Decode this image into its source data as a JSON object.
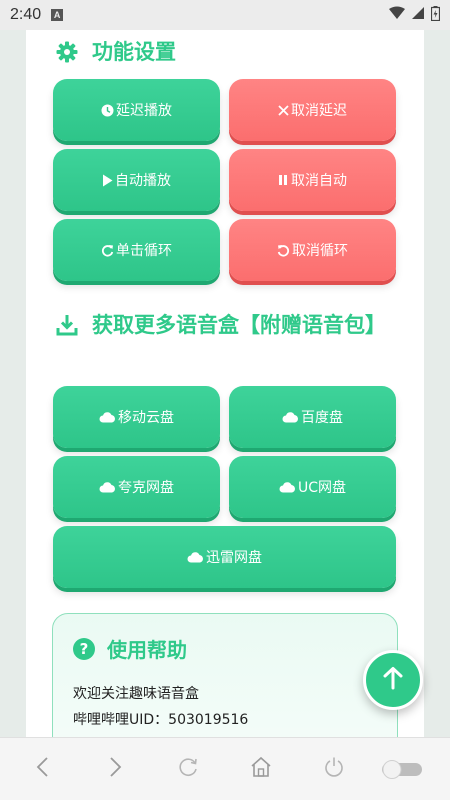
{
  "status_bar": {
    "time": "2:40",
    "a_icon": "A"
  },
  "function_settings": {
    "title": "功能设置",
    "buttons": {
      "delay_play": "延迟播放",
      "cancel_delay": "取消延迟",
      "auto_play": "自动播放",
      "cancel_auto": "取消自动",
      "single_loop": "单击循环",
      "cancel_loop": "取消循环"
    }
  },
  "downloads": {
    "title": "获取更多语音盒【附赠语音包】",
    "buttons": {
      "mobile_cloud": "移动云盘",
      "baidu": "百度盘",
      "quark": "夸克网盘",
      "uc": "UC网盘",
      "xunlei": "迅雷网盘"
    }
  },
  "help": {
    "title": "使用帮助",
    "line1": "欢迎关注趣味语音盒",
    "line2": "哔哩哔哩UID：503019516"
  },
  "colors": {
    "green": "#2fc98a",
    "red": "#fb6e6e"
  }
}
